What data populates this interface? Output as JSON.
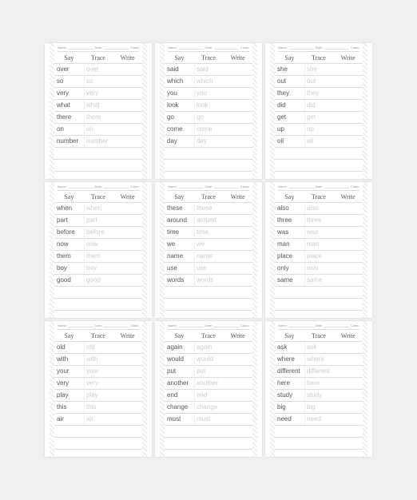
{
  "meta": {
    "name_label": "Name:",
    "date_label": "Date:",
    "class_label": "Class:"
  },
  "columns": {
    "say": "Say",
    "trace": "Trace",
    "write": "Write"
  },
  "worksheets": [
    {
      "words": [
        "over",
        "so",
        "very",
        "what",
        "there",
        "on",
        "number"
      ]
    },
    {
      "words": [
        "said",
        "which",
        "you",
        "look",
        "go",
        "come",
        "day"
      ]
    },
    {
      "words": [
        "she",
        "out",
        "they",
        "did",
        "get",
        "up",
        "oil"
      ]
    },
    {
      "words": [
        "when",
        "part",
        "before",
        "now",
        "them",
        "boy",
        "good"
      ]
    },
    {
      "words": [
        "these",
        "around",
        "time",
        "we",
        "name",
        "use",
        "words"
      ]
    },
    {
      "words": [
        "also",
        "three",
        "was",
        "man",
        "place",
        "only",
        "same"
      ]
    },
    {
      "words": [
        "old",
        "with",
        "your",
        "very",
        "play",
        "this",
        "air"
      ]
    },
    {
      "words": [
        "again",
        "would",
        "put",
        "another",
        "end",
        "change",
        "must"
      ]
    },
    {
      "words": [
        "ask",
        "where",
        "different",
        "here",
        "study",
        "big",
        "need"
      ]
    }
  ]
}
